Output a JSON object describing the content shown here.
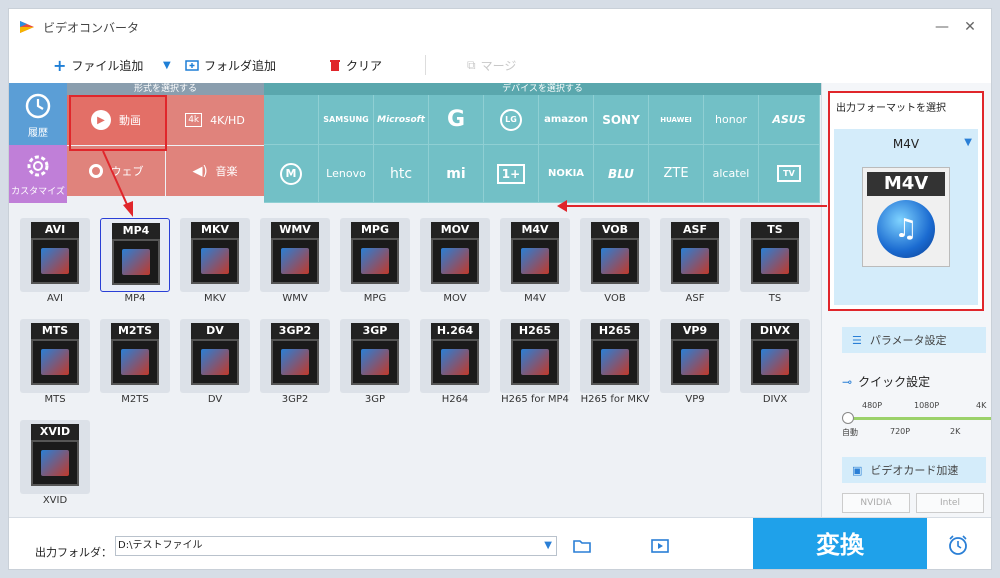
{
  "window": {
    "title": "ビデオコンバータ"
  },
  "toolbar": {
    "add_file": "ファイル追加",
    "add_folder": "フォルダ追加",
    "clear": "クリア",
    "merge": "マージ"
  },
  "sidebar": {
    "history": "履歴",
    "customize": "カスタマイズ"
  },
  "format_panel": {
    "header": "形式を選択する",
    "tiles": [
      {
        "label": "動画",
        "icon": "play-icon"
      },
      {
        "label": "4K/HD",
        "icon": "4k-icon"
      },
      {
        "label": "ウェブ",
        "icon": "chrome-icon"
      },
      {
        "label": "音楽",
        "icon": "speaker-icon"
      }
    ]
  },
  "device_panel": {
    "header": "デバイスを選択する",
    "row1": [
      "",
      "SAMSUNG",
      "Microsoft",
      "G",
      "LG",
      "amazon",
      "SONY",
      "HUAWEI",
      "honor",
      "ASUS"
    ],
    "row2": [
      "",
      "Lenovo",
      "htc",
      "mi",
      "1+",
      "NOKIA",
      "BLU",
      "ZTE",
      "alcatel",
      "TV"
    ]
  },
  "formats": [
    {
      "badge": "AVI",
      "label": "AVI"
    },
    {
      "badge": "MP4",
      "label": "MP4"
    },
    {
      "badge": "MKV",
      "label": "MKV"
    },
    {
      "badge": "WMV",
      "label": "WMV"
    },
    {
      "badge": "MPG",
      "label": "MPG"
    },
    {
      "badge": "MOV",
      "label": "MOV"
    },
    {
      "badge": "M4V",
      "label": "M4V"
    },
    {
      "badge": "VOB",
      "label": "VOB"
    },
    {
      "badge": "ASF",
      "label": "ASF"
    },
    {
      "badge": "TS",
      "label": "TS"
    },
    {
      "badge": "MTS",
      "label": "MTS"
    },
    {
      "badge": "M2TS",
      "label": "M2TS"
    },
    {
      "badge": "DV",
      "label": "DV"
    },
    {
      "badge": "3GP2",
      "label": "3GP2"
    },
    {
      "badge": "3GP",
      "label": "3GP"
    },
    {
      "badge": "H.264",
      "label": "H264"
    },
    {
      "badge": "H265",
      "label": "H265 for MP4"
    },
    {
      "badge": "H265",
      "label": "H265 for MKV"
    },
    {
      "badge": "VP9",
      "label": "VP9"
    },
    {
      "badge": "DIVX",
      "label": "DIVX"
    },
    {
      "badge": "XVID",
      "label": "XVID"
    }
  ],
  "output": {
    "title": "出力フォーマットを選択",
    "format": "M4V",
    "params": "パラメータ設定",
    "quick": "クイック設定",
    "slider_top": [
      "480P",
      "1080P",
      "4K"
    ],
    "slider_bottom": [
      "自動",
      "720P",
      "2K"
    ],
    "gpu": "ビデオカード加速",
    "nvidia": "NVIDIA",
    "intel": "Intel"
  },
  "bottom": {
    "folder_label": "出力フォルダ：",
    "folder_value": "D:\\テストファイル",
    "convert": "変換"
  }
}
